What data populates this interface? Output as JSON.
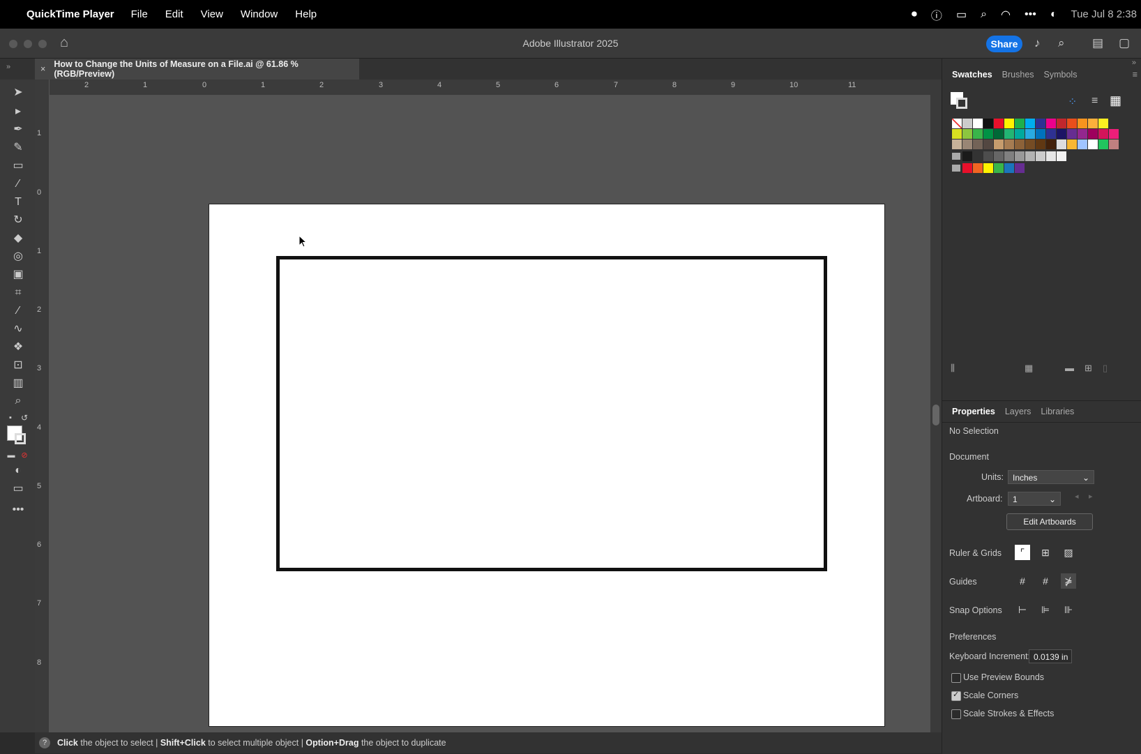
{
  "menubar": {
    "app": "QuickTime Player",
    "items": [
      "File",
      "Edit",
      "View",
      "Window",
      "Help"
    ],
    "clock": "Tue Jul 8  2:38"
  },
  "window": {
    "title": "Adobe Illustrator 2025",
    "share": "Share"
  },
  "document_tab": {
    "title": "How to Change the Units of Measure on a File.ai @ 61.86 % (RGB/Preview)",
    "close": "×"
  },
  "ruler": {
    "h_labels": [
      "2",
      "1",
      "0",
      "1",
      "2",
      "3",
      "4",
      "5",
      "6",
      "7",
      "8",
      "9",
      "10",
      "11"
    ],
    "v_labels": [
      "1",
      "0",
      "1",
      "2",
      "3",
      "4",
      "5",
      "6",
      "7",
      "8"
    ]
  },
  "status": {
    "help": "?",
    "click": "Click",
    "click_text": "the object to select",
    "shift": "Shift+Click",
    "shift_text": "to select multiple object",
    "option": "Option+Drag",
    "option_text": "the object to duplicate",
    "sep": "|"
  },
  "top_panel": {
    "tabs": [
      "Swatches",
      "Brushes",
      "Symbols"
    ],
    "active": "Swatches"
  },
  "swatch_colors": {
    "row1": [
      "#ffffff",
      "#111111",
      "#e8102b",
      "#fff200",
      "#1eb04b",
      "#00adef",
      "#2e3192",
      "#ec008c",
      "#c1272d",
      "#e94e1b",
      "#f7931e",
      "#fbb03b",
      "#fcee21"
    ],
    "row2": [
      "#d9e021",
      "#8cc63f",
      "#39b54a",
      "#009245",
      "#006837",
      "#22b573",
      "#00a99d",
      "#29abe2",
      "#0071bc",
      "#2e3192",
      "#1b1464",
      "#662d91",
      "#93278f",
      "#9e005d",
      "#d4145a",
      "#ed1e79"
    ],
    "row3": [
      "#c7b299",
      "#998675",
      "#736357",
      "#534741",
      "#c69c6d",
      "#a67c52",
      "#8c6239",
      "#754c24",
      "#603813",
      "#42210b",
      "#dddddd",
      "#f7b733",
      "#a0c4ff",
      "#ffffff",
      "#22c55e",
      "#c08080"
    ],
    "row4": [
      "#1a1a1a",
      "#333333",
      "#4d4d4d",
      "#666666",
      "#808080",
      "#999999",
      "#b3b3b3",
      "#cccccc",
      "#e6e6e6",
      "#f2f2f2"
    ],
    "row5": [
      "#e8102b",
      "#f26522",
      "#fff200",
      "#39b54a",
      "#1b75bc",
      "#662d91"
    ]
  },
  "bottom_panel": {
    "tabs": [
      "Properties",
      "Layers",
      "Libraries"
    ],
    "active": "Properties",
    "no_selection": "No Selection",
    "document": "Document",
    "units_label": "Units:",
    "units_value": "Inches",
    "artboard_label": "Artboard:",
    "artboard_value": "1",
    "edit_artboards": "Edit Artboards",
    "ruler_grids": "Ruler & Grids",
    "guides": "Guides",
    "snap_options": "Snap Options",
    "preferences": "Preferences",
    "keyboard_increment_label": "Keyboard Increment:",
    "keyboard_increment_value": "0.0139 in",
    "use_preview_bounds": "Use Preview Bounds",
    "scale_corners": "Scale Corners",
    "scale_strokes": "Scale Strokes & Effects"
  },
  "checkboxes": {
    "use_preview_bounds": false,
    "scale_corners": true,
    "scale_strokes": false
  }
}
